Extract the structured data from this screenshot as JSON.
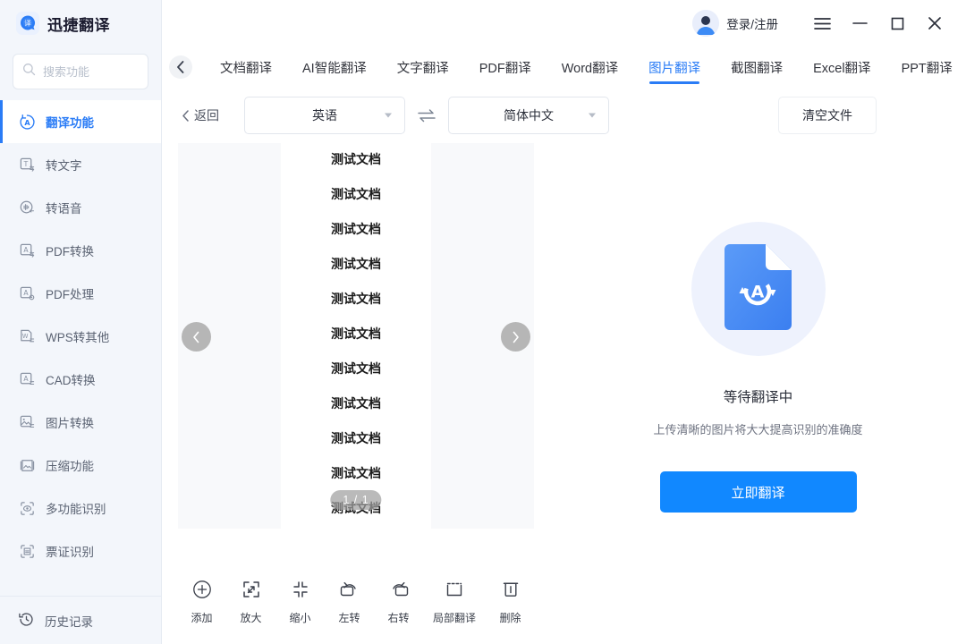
{
  "app": {
    "brand_name": "迅捷翻译",
    "logo_icon": "translate-logo-icon"
  },
  "sidebar": {
    "search": {
      "placeholder": "搜索功能",
      "value": "",
      "icon": "search-icon"
    },
    "items": [
      {
        "label": "翻译功能",
        "icon": "translate-circle-icon",
        "active": true
      },
      {
        "label": "转文字",
        "icon": "text-convert-icon",
        "active": false
      },
      {
        "label": "转语音",
        "icon": "voice-convert-icon",
        "active": false
      },
      {
        "label": "PDF转换",
        "icon": "pdf-convert-icon",
        "active": false
      },
      {
        "label": "PDF处理",
        "icon": "pdf-process-icon",
        "active": false
      },
      {
        "label": "WPS转其他",
        "icon": "wps-convert-icon",
        "active": false
      },
      {
        "label": "CAD转换",
        "icon": "cad-convert-icon",
        "active": false
      },
      {
        "label": "图片转换",
        "icon": "image-convert-icon",
        "active": false
      },
      {
        "label": "压缩功能",
        "icon": "compress-icon",
        "active": false
      },
      {
        "label": "多功能识别",
        "icon": "multi-recognize-icon",
        "active": false
      },
      {
        "label": "票证识别",
        "icon": "invoice-recognize-icon",
        "active": false
      }
    ],
    "bottom_item": {
      "label": "历史记录",
      "icon": "history-icon"
    }
  },
  "titlebar": {
    "account_label": "登录/注册",
    "avatar_icon": "user-avatar-icon",
    "menu_icon": "hamburger-menu-icon",
    "minimize_icon": "minimize-icon",
    "maximize_icon": "maximize-icon",
    "close_icon": "close-icon"
  },
  "tabbar": {
    "back_icon": "chevron-left-icon",
    "tabs": [
      {
        "label": "文档翻译",
        "active": false
      },
      {
        "label": "AI智能翻译",
        "active": false
      },
      {
        "label": "文字翻译",
        "active": false
      },
      {
        "label": "PDF翻译",
        "active": false
      },
      {
        "label": "Word翻译",
        "active": false
      },
      {
        "label": "图片翻译",
        "active": true
      },
      {
        "label": "截图翻译",
        "active": false
      },
      {
        "label": "Excel翻译",
        "active": false
      },
      {
        "label": "PPT翻译",
        "active": false
      }
    ]
  },
  "langbar": {
    "back_label": "返回",
    "back_icon": "chevron-left-icon",
    "source_language": "英语",
    "target_language": "简体中文",
    "swap_icon": "swap-arrows-icon",
    "clear_label": "清空文件"
  },
  "preview": {
    "doc_lines": [
      "测试文档",
      "测试文档",
      "测试文档",
      "测试文档",
      "测试文档",
      "测试文档",
      "测试文档",
      "测试文档",
      "测试文档",
      "测试文档",
      "测试文档"
    ],
    "page_indicator": "1 / 1",
    "prev_icon": "chevron-left-icon",
    "next_icon": "chevron-right-icon",
    "tools": [
      {
        "label": "添加",
        "icon": "plus-circle-icon"
      },
      {
        "label": "放大",
        "icon": "zoom-in-expand-icon"
      },
      {
        "label": "缩小",
        "icon": "zoom-out-collapse-icon"
      },
      {
        "label": "左转",
        "icon": "rotate-left-icon"
      },
      {
        "label": "右转",
        "icon": "rotate-right-icon"
      },
      {
        "label": "局部翻译",
        "icon": "partial-translate-icon"
      },
      {
        "label": "删除",
        "icon": "trash-icon"
      }
    ]
  },
  "result": {
    "status_icon": "document-translate-icon",
    "title": "等待翻译中",
    "subtitle": "上传清晰的图片将大大提高识别的准确度",
    "button_label": "立即翻译"
  },
  "colors": {
    "accent": "#2a7cf6",
    "primary_button": "#1188ff",
    "sidebar_bg": "#f3f6fb",
    "panel_gray": "#f8f9fb",
    "text_primary": "#2b2f3a",
    "text_secondary": "#6d7280"
  }
}
